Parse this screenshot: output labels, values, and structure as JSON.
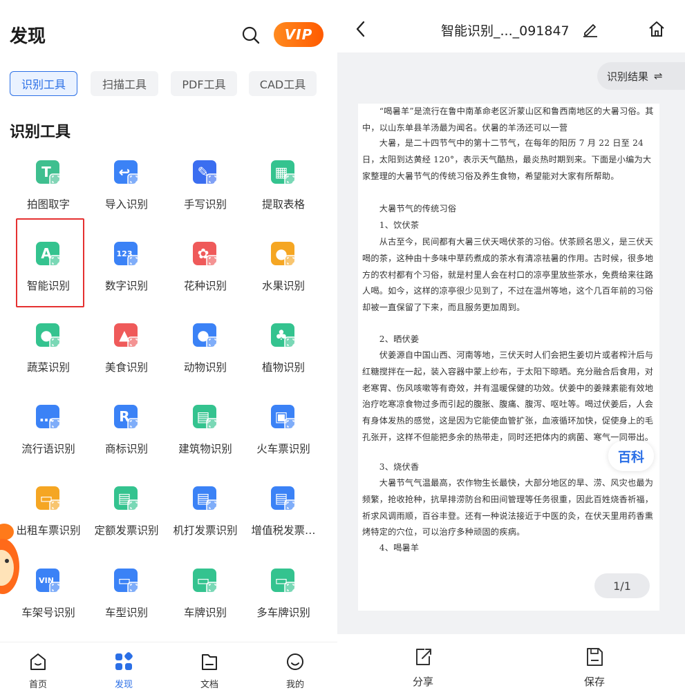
{
  "left": {
    "title": "发现",
    "vip_label": "VIP",
    "tabs": [
      {
        "label": "识别工具",
        "active": true
      },
      {
        "label": "扫描工具",
        "active": false
      },
      {
        "label": "PDF工具",
        "active": false
      },
      {
        "label": "CAD工具",
        "active": false
      }
    ],
    "section_title": "识别工具",
    "tools": [
      {
        "label": "拍图取字",
        "icon": "photo-text-icon",
        "glyph": "T",
        "color": "#3fbf8f"
      },
      {
        "label": "导入识别",
        "icon": "import-icon",
        "glyph": "↩",
        "color": "#3b82f6"
      },
      {
        "label": "手写识别",
        "icon": "handwriting-icon",
        "glyph": "✎",
        "color": "#3b6ef0"
      },
      {
        "label": "提取表格",
        "icon": "table-icon",
        "glyph": "▦",
        "color": "#34c38f"
      },
      {
        "label": "智能识别",
        "icon": "smart-recognition-icon",
        "glyph": "A",
        "color": "#34c38f"
      },
      {
        "label": "数字识别",
        "icon": "number-icon",
        "glyph": "123",
        "color": "#3b82f6"
      },
      {
        "label": "花种识别",
        "icon": "flower-icon",
        "glyph": "✿",
        "color": "#ef5a5a"
      },
      {
        "label": "水果识别",
        "icon": "fruit-icon",
        "glyph": "●",
        "color": "#f5a623"
      },
      {
        "label": "蔬菜识别",
        "icon": "vegetable-icon",
        "glyph": "●",
        "color": "#34c38f"
      },
      {
        "label": "美食识别",
        "icon": "food-icon",
        "glyph": "▲",
        "color": "#ef5a5a"
      },
      {
        "label": "动物识别",
        "icon": "animal-icon",
        "glyph": "●",
        "color": "#3b82f6"
      },
      {
        "label": "植物识别",
        "icon": "plant-icon",
        "glyph": "♣",
        "color": "#34c38f"
      },
      {
        "label": "流行语识别",
        "icon": "chat-icon",
        "glyph": "…",
        "color": "#3b82f6"
      },
      {
        "label": "商标识别",
        "icon": "trademark-icon",
        "glyph": "R",
        "color": "#3b82f6"
      },
      {
        "label": "建筑物识别",
        "icon": "building-icon",
        "glyph": "▤",
        "color": "#34c38f"
      },
      {
        "label": "火车票识别",
        "icon": "train-ticket-icon",
        "glyph": "▣",
        "color": "#3b82f6"
      },
      {
        "label": "出租车票识别",
        "icon": "taxi-ticket-icon",
        "glyph": "▭",
        "color": "#f5a623"
      },
      {
        "label": "定额发票识别",
        "icon": "quota-invoice-icon",
        "glyph": "▤",
        "color": "#34c38f"
      },
      {
        "label": "机打发票识别",
        "icon": "printed-invoice-icon",
        "glyph": "▤",
        "color": "#3b82f6"
      },
      {
        "label": "增值税发票…",
        "icon": "vat-invoice-icon",
        "glyph": "▤",
        "color": "#3b82f6"
      },
      {
        "label": "车架号识别",
        "icon": "vin-icon",
        "glyph": "VIN",
        "color": "#3b82f6"
      },
      {
        "label": "车型识别",
        "icon": "car-model-icon",
        "glyph": "▭",
        "color": "#3b82f6"
      },
      {
        "label": "车牌识别",
        "icon": "license-plate-icon",
        "glyph": "▭",
        "color": "#34c38f"
      },
      {
        "label": "多车牌识别",
        "icon": "multi-plate-icon",
        "glyph": "▭",
        "color": "#34c38f"
      }
    ],
    "nav": [
      {
        "label": "首页",
        "icon": "home-tab-icon",
        "active": false
      },
      {
        "label": "发现",
        "icon": "discover-tab-icon",
        "active": true
      },
      {
        "label": "文档",
        "icon": "document-tab-icon",
        "active": false
      },
      {
        "label": "我的",
        "icon": "profile-tab-icon",
        "active": false
      }
    ]
  },
  "right": {
    "doc_title": "智能识别_..._091847",
    "result_label": "识别结果",
    "result_icon": "⇌",
    "paragraphs": [
      "　　大暑，是二十四节气中的第十二节气，在每年的阳历 7 月 22 日至 24 日，太阳到达黄经 120°，表示天气酷热，最炎热时期到来。下面是小编为大家整理的大暑节气的传统习俗及养生食物，希望能对大家有所帮助。",
      "　　大暑节气的传统习俗",
      "　　1、饮伏茶",
      "　　从古至今，民间都有大暑三伏天喝伏茶的习俗。伏茶顾名思义，是三伏天喝的茶，这种由十多味中草药煮成的茶水有清凉祛暑的作用。古时候，很多地方的农村都有个习俗，就是村里人会在村口的凉亭里放些茶水，免费给来往路人喝。如今，这样的凉亭很少见到了，不过在温州等地，这个几百年前的习俗却被一直保留了下来，而且服务更加周到。",
      "　　2、晒伏姜",
      "　　伏姜源自中国山西、河南等地，三伏天时人们会把生姜切片或者榨汁后与红糖搅拌在一起，装入容器中蒙上纱布，于太阳下晾晒。充分融合后食用，对老寒胃、伤风咳嗽等有奇效，并有温暖保健的功效。伏姜中的姜辣素能有效地治疗吃寒凉食物过多而引起的腹胀、腹痛、腹泻、呕吐等。喝过伏姜后，人会有身体发热的感觉，这是因为它能使血管扩张，血液循环加快，促使身上的毛孔张开，这样不但能把多余的热带走，同时还把体内的病菌、寒气一同带出。",
      "　　3、烧伏香",
      "　　大暑节气气温最高，农作物生长最快，大部分地区的旱、涝、风灾也最为频繁，抢收抢种，抗旱排涝防台和田间管理等任务很重，因此百姓烧香祈福，祈求风调雨顺，百谷丰登。还有一种说法接近于中医的灸，在伏天里用药香熏烤特定的穴位，可以治疗多种顽固的疾病。",
      "　　4、喝暑羊",
      "　　“喝暑羊”是流行在鲁中南革命老区沂蒙山区和鲁西南地区的大暑习俗。其中，以山东单县羊汤最为闻名。伏暑的羊汤还可以一营"
    ],
    "baike_label": "百科",
    "page_indicator": "1/1",
    "actions": [
      {
        "label": "分享",
        "icon": "share-icon"
      },
      {
        "label": "保存",
        "icon": "save-icon"
      }
    ]
  }
}
